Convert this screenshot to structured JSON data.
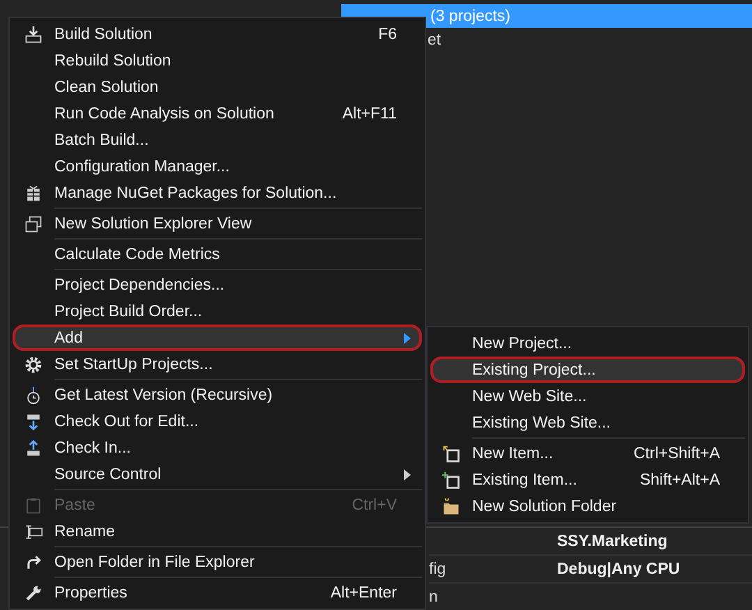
{
  "solution_explorer": {
    "header": "(3 projects)",
    "items": [
      "et"
    ]
  },
  "context_menu": {
    "items": [
      {
        "kind": "item",
        "label": "Build Solution",
        "shortcut": "F6",
        "disabled": false,
        "selected": false,
        "submenu": false,
        "annotated": false
      },
      {
        "kind": "item",
        "label": "Rebuild Solution",
        "disabled": false,
        "selected": false,
        "submenu": false,
        "annotated": false
      },
      {
        "kind": "item",
        "label": "Clean Solution",
        "disabled": false,
        "selected": false,
        "submenu": false,
        "annotated": false
      },
      {
        "kind": "item",
        "label": "Run Code Analysis on Solution",
        "shortcut": "Alt+F11",
        "disabled": false,
        "selected": false,
        "submenu": false,
        "annotated": false
      },
      {
        "kind": "item",
        "label": "Batch Build...",
        "disabled": false,
        "selected": false,
        "submenu": false,
        "annotated": false
      },
      {
        "kind": "item",
        "label": "Configuration Manager...",
        "disabled": false,
        "selected": false,
        "submenu": false,
        "annotated": false
      },
      {
        "kind": "item",
        "label": "Manage NuGet Packages for Solution...",
        "disabled": false,
        "selected": false,
        "submenu": false,
        "annotated": false
      },
      {
        "kind": "separator"
      },
      {
        "kind": "item",
        "label": "New Solution Explorer View",
        "disabled": false,
        "selected": false,
        "submenu": false,
        "annotated": false
      },
      {
        "kind": "separator"
      },
      {
        "kind": "item",
        "label": "Calculate Code Metrics",
        "disabled": false,
        "selected": false,
        "submenu": false,
        "annotated": false
      },
      {
        "kind": "separator"
      },
      {
        "kind": "item",
        "label": "Project Dependencies...",
        "disabled": false,
        "selected": false,
        "submenu": false,
        "annotated": false
      },
      {
        "kind": "item",
        "label": "Project Build Order...",
        "disabled": false,
        "selected": false,
        "submenu": false,
        "annotated": false
      },
      {
        "kind": "item",
        "label": "Add",
        "disabled": false,
        "selected": true,
        "submenu": true,
        "annotated": true
      },
      {
        "kind": "item",
        "label": "Set StartUp Projects...",
        "disabled": false,
        "selected": false,
        "submenu": false,
        "annotated": false
      },
      {
        "kind": "separator"
      },
      {
        "kind": "item",
        "label": "Get Latest Version (Recursive)",
        "disabled": false,
        "selected": false,
        "submenu": false,
        "annotated": false
      },
      {
        "kind": "item",
        "label": "Check Out for Edit...",
        "disabled": false,
        "selected": false,
        "submenu": false,
        "annotated": false
      },
      {
        "kind": "item",
        "label": "Check In...",
        "disabled": false,
        "selected": false,
        "submenu": false,
        "annotated": false
      },
      {
        "kind": "item",
        "label": "Source Control",
        "disabled": false,
        "selected": false,
        "submenu": true,
        "annotated": false
      },
      {
        "kind": "separator"
      },
      {
        "kind": "item",
        "label": "Paste",
        "shortcut": "Ctrl+V",
        "disabled": true,
        "selected": false,
        "submenu": false,
        "annotated": false
      },
      {
        "kind": "item",
        "label": "Rename",
        "disabled": false,
        "selected": false,
        "submenu": false,
        "annotated": false
      },
      {
        "kind": "separator"
      },
      {
        "kind": "item",
        "label": "Open Folder in File Explorer",
        "disabled": false,
        "selected": false,
        "submenu": false,
        "annotated": false
      },
      {
        "kind": "separator"
      },
      {
        "kind": "item",
        "label": "Properties",
        "shortcut": "Alt+Enter",
        "disabled": false,
        "selected": false,
        "submenu": false,
        "annotated": false
      }
    ]
  },
  "add_submenu": {
    "items": [
      {
        "kind": "item",
        "label": "New Project...",
        "disabled": false,
        "selected": false,
        "annotated": false
      },
      {
        "kind": "item",
        "label": "Existing Project...",
        "disabled": false,
        "selected": true,
        "annotated": true
      },
      {
        "kind": "item",
        "label": "New Web Site...",
        "disabled": false,
        "selected": false,
        "annotated": false
      },
      {
        "kind": "item",
        "label": "Existing Web Site...",
        "disabled": false,
        "selected": false,
        "annotated": false
      },
      {
        "kind": "separator"
      },
      {
        "kind": "item",
        "label": "New Item...",
        "shortcut": "Ctrl+Shift+A",
        "disabled": false,
        "selected": false,
        "annotated": false
      },
      {
        "kind": "item",
        "label": "Existing Item...",
        "shortcut": "Shift+Alt+A",
        "disabled": false,
        "selected": false,
        "annotated": false
      },
      {
        "kind": "item",
        "label": "New Solution Folder",
        "disabled": false,
        "selected": false,
        "annotated": false
      }
    ]
  },
  "properties": {
    "rows": [
      {
        "value": "SSY.Marketing"
      },
      {
        "name": "fig",
        "value": "Debug|Any CPU"
      },
      {
        "name": "n"
      }
    ]
  }
}
